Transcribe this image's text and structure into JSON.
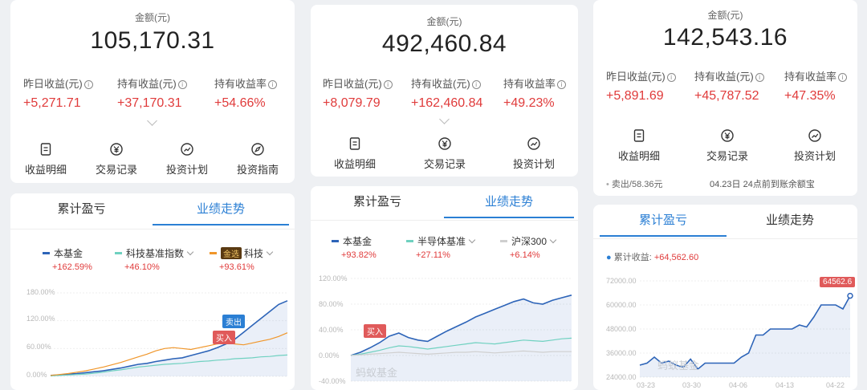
{
  "colors": {
    "red": "#e03b3b",
    "blue": "#2b7fd4",
    "fund_line": "#2d64b8",
    "orange": "#f0962a",
    "teal": "#6fd1c0",
    "gray_line": "#cfcfcf"
  },
  "panels": [
    {
      "amount_label": "金额(元)",
      "amount": "105,170.31",
      "stats": [
        {
          "label": "昨日收益(元)",
          "value": "+5,271.71"
        },
        {
          "label": "持有收益(元)",
          "value": "+37,170.31"
        },
        {
          "label": "持有收益率",
          "value": "+54.66%"
        }
      ],
      "actions": [
        {
          "label": "收益明细",
          "icon": "document-icon"
        },
        {
          "label": "交易记录",
          "icon": "yen-circle-icon"
        },
        {
          "label": "投资计划",
          "icon": "trend-circle-icon"
        },
        {
          "label": "投资指南",
          "icon": "compass-icon"
        }
      ],
      "tabs": [
        "累计盈亏",
        "业绩走势"
      ],
      "active_tab": 1,
      "legend": [
        {
          "name": "本基金",
          "value": "+162.59%",
          "color": "#2d64b8"
        },
        {
          "name": "科技基准指数",
          "value": "+46.10%",
          "color": "#6fd1c0"
        },
        {
          "badge": "金选",
          "name": "科技",
          "value": "+93.61%",
          "color": "#f0962a"
        }
      ],
      "y_ticks": [
        "180.00%",
        "120.00%",
        "60.00%",
        "0.00%"
      ],
      "markers": {
        "sell": "卖出",
        "buy": "买入"
      }
    },
    {
      "amount_label": "金额(元)",
      "amount": "492,460.84",
      "stats": [
        {
          "label": "昨日收益(元)",
          "value": "+8,079.79"
        },
        {
          "label": "持有收益(元)",
          "value": "+162,460.84"
        },
        {
          "label": "持有收益率",
          "value": "+49.23%"
        }
      ],
      "actions": [
        {
          "label": "收益明细",
          "icon": "document-icon"
        },
        {
          "label": "交易记录",
          "icon": "yen-circle-icon"
        },
        {
          "label": "投资计划",
          "icon": "trend-circle-icon"
        }
      ],
      "tabs": [
        "累计盈亏",
        "业绩走势"
      ],
      "active_tab": 1,
      "legend": [
        {
          "name": "本基金",
          "value": "+93.82%",
          "color": "#2d64b8"
        },
        {
          "name": "半导体基准",
          "value": "+27.11%",
          "color": "#6fd1c0"
        },
        {
          "name": "沪深300",
          "value": "+6.14%",
          "color": "#cfcfcf"
        }
      ],
      "y_ticks": [
        "120.00%",
        "80.00%",
        "40.00%",
        "0.00%",
        "-40.00%"
      ],
      "markers": {
        "buy": "买入"
      },
      "watermark": "蚂蚁基金"
    },
    {
      "amount_label": "金额(元)",
      "amount": "142,543.16",
      "stats": [
        {
          "label": "昨日收益(元)",
          "value": "+5,891.69"
        },
        {
          "label": "持有收益(元)",
          "value": "+45,787.52"
        },
        {
          "label": "持有收益率",
          "value": "+47.35%"
        }
      ],
      "actions": [
        {
          "label": "收益明细",
          "icon": "document-icon"
        },
        {
          "label": "交易记录",
          "icon": "yen-circle-icon"
        },
        {
          "label": "投资计划",
          "icon": "trend-circle-icon"
        }
      ],
      "notice": {
        "left": "卖出/58.36元",
        "right": "04.23日 24点前到账余额宝"
      },
      "tabs": [
        "累计盈亏",
        "业绩走势"
      ],
      "active_tab": 0,
      "cumulative": {
        "label": "累计收益:",
        "value": "+64,562.60"
      },
      "y_ticks": [
        "72000.00",
        "60000.00",
        "48000.00",
        "36000.00",
        "24000.00"
      ],
      "x_ticks": [
        "03-23",
        "03-30",
        "04-06",
        "04-13",
        "04-22"
      ],
      "tooltip": "64562.6",
      "watermark": "蚂蚁基金"
    }
  ],
  "chart_data": [
    {
      "type": "line",
      "series": [
        {
          "name": "本基金",
          "values": [
            2,
            3,
            5,
            6,
            8,
            10,
            12,
            15,
            18,
            22,
            26,
            28,
            32,
            35,
            38,
            40,
            45,
            50,
            55,
            62,
            70,
            80,
            95,
            110,
            125,
            140,
            155,
            163
          ]
        },
        {
          "name": "科技基准指数",
          "values": [
            1,
            2,
            3,
            4,
            5,
            7,
            9,
            12,
            14,
            17,
            20,
            22,
            24,
            26,
            27,
            28,
            30,
            32,
            33,
            35,
            36,
            38,
            39,
            40,
            42,
            43,
            45,
            46
          ]
        },
        {
          "name": "科技",
          "values": [
            2,
            4,
            6,
            9,
            12,
            16,
            20,
            25,
            30,
            36,
            42,
            48,
            55,
            60,
            62,
            60,
            58,
            62,
            66,
            70,
            72,
            70,
            68,
            72,
            76,
            80,
            86,
            94
          ]
        }
      ],
      "ylim": [
        0,
        180
      ]
    },
    {
      "type": "line",
      "series": [
        {
          "name": "本基金",
          "values": [
            0,
            5,
            12,
            20,
            30,
            35,
            28,
            24,
            22,
            30,
            38,
            45,
            52,
            60,
            66,
            72,
            78,
            84,
            88,
            82,
            80,
            86,
            90,
            94
          ]
        },
        {
          "name": "半导体基准",
          "values": [
            0,
            2,
            5,
            8,
            12,
            15,
            14,
            12,
            10,
            12,
            14,
            16,
            18,
            20,
            19,
            18,
            20,
            22,
            24,
            23,
            22,
            24,
            26,
            27
          ]
        },
        {
          "name": "沪深300",
          "values": [
            0,
            1,
            2,
            3,
            4,
            5,
            4,
            3,
            2,
            3,
            4,
            5,
            5,
            6,
            5,
            4,
            5,
            6,
            7,
            6,
            5,
            6,
            6,
            6
          ]
        }
      ],
      "ylim": [
        -40,
        120
      ]
    },
    {
      "type": "line",
      "series": [
        {
          "name": "累计收益",
          "values": [
            30000,
            31000,
            34000,
            31000,
            32000,
            30000,
            29000,
            33000,
            28000,
            31000,
            31000,
            31000,
            31000,
            31000,
            34000,
            36000,
            45000,
            45000,
            48000,
            48000,
            48000,
            48000,
            50000,
            49000,
            54000,
            60000,
            60000,
            60000,
            58000,
            64562.6
          ]
        }
      ],
      "x": [
        "03-23",
        "03-30",
        "04-06",
        "04-13",
        "04-22"
      ],
      "ylim": [
        24000,
        72000
      ]
    }
  ]
}
